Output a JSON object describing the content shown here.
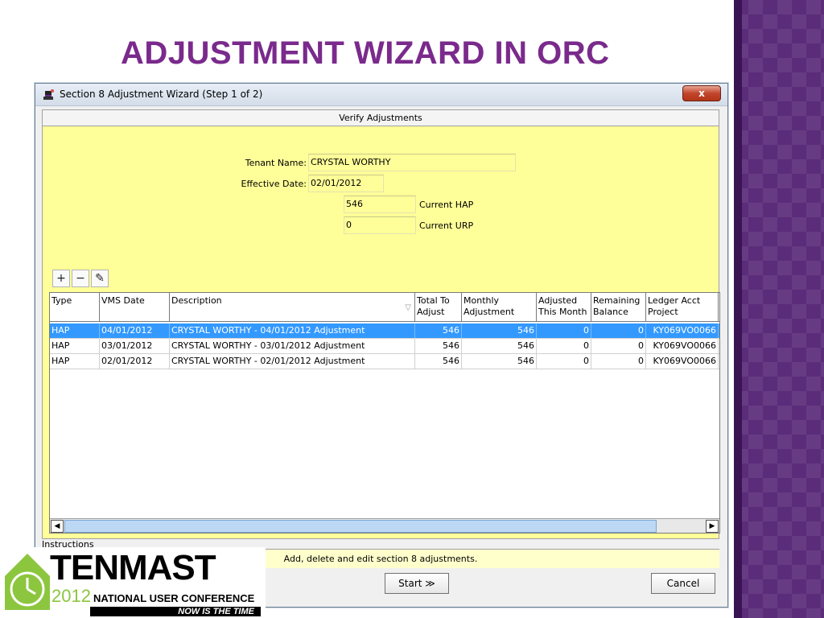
{
  "slide": {
    "title": "ADJUSTMENT WIZARD IN ORC"
  },
  "window": {
    "title": "Section 8 Adjustment Wizard (Step 1 of 2)",
    "close_label": "x"
  },
  "panel": {
    "header": "Verify Adjustments",
    "tenant_label": "Tenant Name:",
    "tenant_value": "CRYSTAL WORTHY",
    "effective_label": "Effective Date:",
    "effective_value": "02/01/2012",
    "hap_value": "546",
    "hap_label": "Current HAP",
    "urp_value": "0",
    "urp_label": "Current URP"
  },
  "toolbar": {
    "add_icon": "plus-icon",
    "remove_icon": "minus-icon",
    "edit_icon": "pencil-icon",
    "add_label": "+",
    "remove_label": "−",
    "edit_label": "✎"
  },
  "grid": {
    "columns": [
      {
        "label": "Type"
      },
      {
        "label": "VMS Date"
      },
      {
        "label": "Description"
      },
      {
        "label": "Total To Adjust"
      },
      {
        "label": "Monthly Adjustment"
      },
      {
        "label": "Adjusted This Month"
      },
      {
        "label": "Remaining Balance"
      },
      {
        "label": "Ledger Acct Project"
      }
    ],
    "rows": [
      {
        "type": "HAP",
        "date": "04/01/2012",
        "desc": "CRYSTAL WORTHY - 04/01/2012 Adjustment",
        "total": "546",
        "monthly": "546",
        "adjusted": "0",
        "remaining": "0",
        "ledger": "KY069VO0066",
        "selected": true
      },
      {
        "type": "HAP",
        "date": "03/01/2012",
        "desc": "CRYSTAL WORTHY - 03/01/2012 Adjustment",
        "total": "546",
        "monthly": "546",
        "adjusted": "0",
        "remaining": "0",
        "ledger": "KY069VO0066",
        "selected": false
      },
      {
        "type": "HAP",
        "date": "02/01/2012",
        "desc": "CRYSTAL WORTHY - 02/01/2012 Adjustment",
        "total": "546",
        "monthly": "546",
        "adjusted": "0",
        "remaining": "0",
        "ledger": "KY069VO0066",
        "selected": false
      }
    ]
  },
  "instructions": {
    "legend": "Instructions",
    "text": "Add, delete and edit section 8 adjustments."
  },
  "buttons": {
    "start": "Start ≫",
    "cancel": "Cancel"
  },
  "logo": {
    "word": "TENMAST",
    "year": "2012",
    "conference": "NATIONAL USER CONFERENCE",
    "tagline": "NOW IS THE TIME"
  },
  "colors": {
    "title": "#7a2a8c",
    "panel": "#ffff99",
    "selection": "#3399ff",
    "band": "#5b2c7a"
  }
}
